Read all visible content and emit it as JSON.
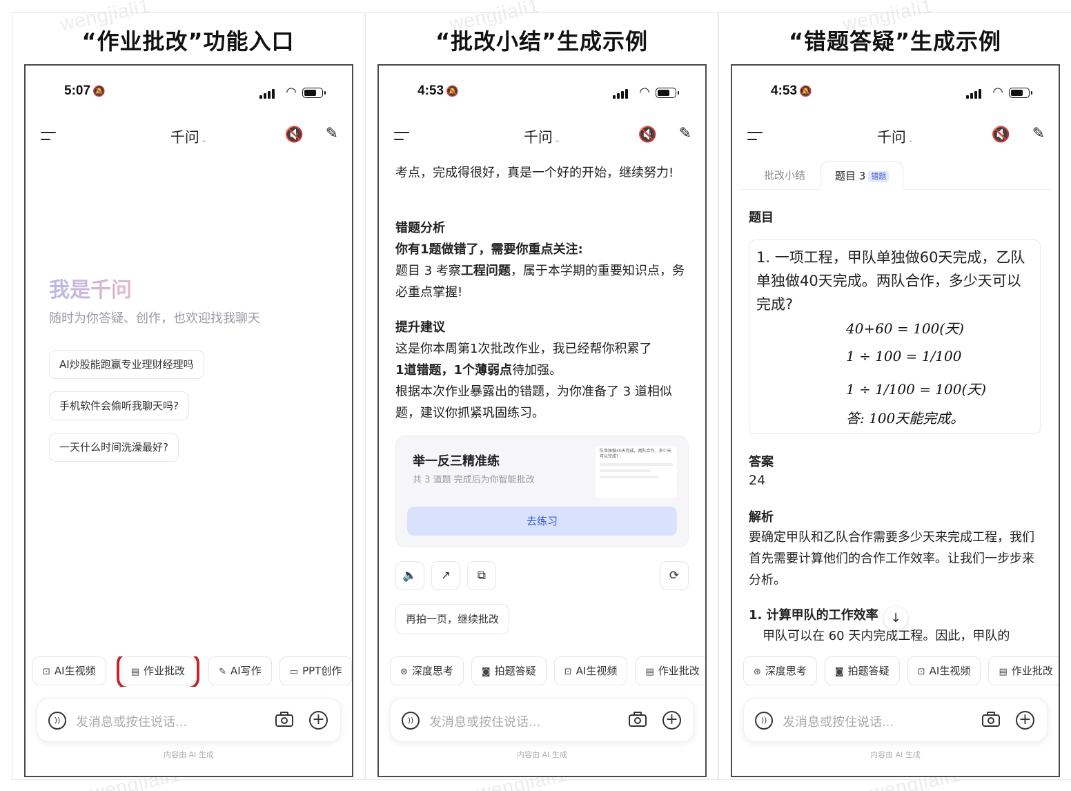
{
  "panels": [
    {
      "title": "“作业批改”功能入口",
      "status": {
        "time": "5:07"
      },
      "nav": {
        "title": "千问"
      },
      "hero": {
        "title": "我是千问",
        "subtitle": "随时为你答疑、创作，也欢迎找我聊天"
      },
      "suggestions": [
        "AI炒股能跑赢专业理财经理吗",
        "手机软件会偷听我聊天吗?",
        "一天什么时间洗澡最好?"
      ],
      "chips": [
        "AI生视频",
        "作业批改",
        "AI写作",
        "PPT创作"
      ],
      "input_placeholder": "发消息或按住说话...",
      "footnote": "内容由 AI 生成"
    },
    {
      "title": "“批改小结”生成示例",
      "status": {
        "time": "4:53"
      },
      "nav": {
        "title": "千问"
      },
      "intro": "考点，完成得很好，真是一个好的开始，继续努力!",
      "wrong": {
        "heading": "错题分析",
        "lead": "你有1题做错了，需要你重点关注:",
        "body_prefix": "题目 3 考察",
        "body_em": "工程问题",
        "body_suffix": "，属于本学期的重要知识点，务必重点掌握!"
      },
      "advice": {
        "heading": "提升建议",
        "line1": "这是你本周第1次批改作业，我已经帮你积累了",
        "line2_em1": "1道错题，1个薄弱点",
        "line2_rest": "待加强。",
        "line3": "根据本次作业暴露出的错题，为你准备了 3 道相似题，建议你抓紧巩固练习。"
      },
      "practice": {
        "title": "举一反三精准练",
        "subtitle": "共 3 道题 完成后为你智能批改",
        "thumb_text": "队单独做40天完成。两队合作，多少天可以完成?",
        "button": "去练习"
      },
      "again_button": "再拍一页，继续批改",
      "chips": [
        "深度思考",
        "拍题答疑",
        "AI生视频",
        "作业批改"
      ],
      "input_placeholder": "发消息或按住说话...",
      "footnote": "内容由 AI 生成"
    },
    {
      "title": "“错题答疑”生成示例",
      "status": {
        "time": "4:53"
      },
      "nav": {
        "title": "千问"
      },
      "tabs": [
        {
          "label": "批改小结"
        },
        {
          "label": "题目 3",
          "tag": "错题"
        }
      ],
      "question": {
        "heading": "题目",
        "text": "1. 一项工程，甲队单独做60天完成，乙队单独做40天完成。两队合作，多少天可以完成?",
        "work": [
          "40+60 = 100(天)",
          "1 ÷ 100 = 1/100",
          "1 ÷ 1/100 = 100(天)",
          "答: 100天能完成。"
        ]
      },
      "answer": {
        "heading": "答案",
        "value": "24"
      },
      "analysis": {
        "heading": "解析",
        "text": "要确定甲队和乙队合作需要多少天来完成工程，我们首先需要计算他们的合作工作效率。让我们一步步来分析。"
      },
      "step": {
        "heading": "1. 计算甲队的工作效率",
        "text": "甲队可以在 60 天内完成工程。因此，甲队的"
      },
      "chips": [
        "深度思考",
        "拍题答疑",
        "AI生视频",
        "作业批改"
      ],
      "input_placeholder": "发消息或按住说话...",
      "footnote": "内容由 AI 生成"
    }
  ]
}
